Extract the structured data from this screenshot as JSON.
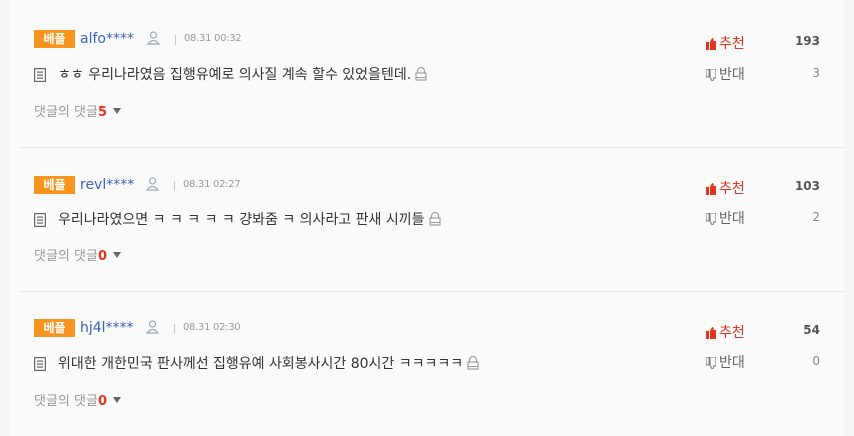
{
  "comments": [
    {
      "badge": "베플",
      "user": "alfo****",
      "time": "08.31 00:32",
      "text": "ㅎㅎ 우리나라였음 집행유예로 의사질 계속 할수 있었을텐데.",
      "replies_label": "댓글의 댓글",
      "replies_count": "5",
      "recommend_label": "추천",
      "recommend_count": "193",
      "oppose_label": "반대",
      "oppose_count": "3"
    },
    {
      "badge": "베플",
      "user": "revl****",
      "time": "08.31 02:27",
      "text": "우리나라였으면 ㅋ ㅋ ㅋ ㅋ ㅋ 걍봐줌 ㅋ 의사라고 판새 시끼들",
      "replies_label": "댓글의 댓글",
      "replies_count": "0",
      "recommend_label": "추천",
      "recommend_count": "103",
      "oppose_label": "반대",
      "oppose_count": "2"
    },
    {
      "badge": "베플",
      "user": "hj4l****",
      "time": "08.31 02:30",
      "text": "위대한 개한민국 판사께선 집행유예 사회봉사시간 80시간 ㅋㅋㅋㅋㅋ",
      "replies_label": "댓글의 댓글",
      "replies_count": "0",
      "recommend_label": "추천",
      "recommend_count": "54",
      "oppose_label": "반대",
      "oppose_count": "0"
    }
  ],
  "colors": {
    "badge": "#f7941d",
    "username": "#3a63b8",
    "accent_red": "#e4331f"
  }
}
